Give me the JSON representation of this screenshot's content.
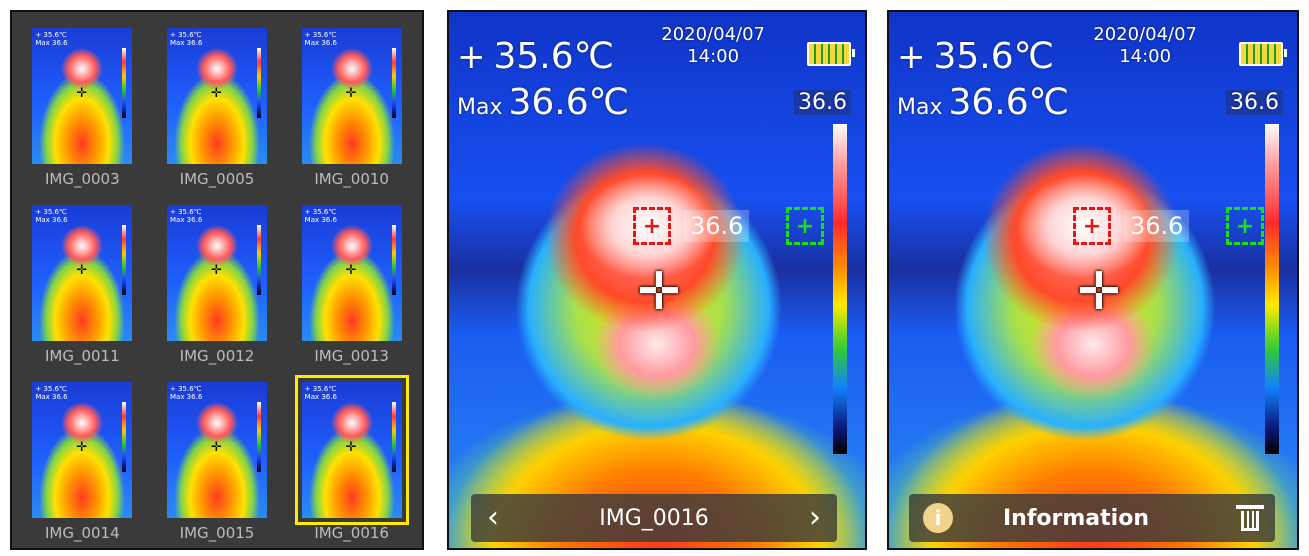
{
  "gallery": {
    "items": [
      {
        "name": "IMG_0003"
      },
      {
        "name": "IMG_0005"
      },
      {
        "name": "IMG_0010"
      },
      {
        "name": "IMG_0011"
      },
      {
        "name": "IMG_0012"
      },
      {
        "name": "IMG_0013"
      },
      {
        "name": "IMG_0014"
      },
      {
        "name": "IMG_0015"
      },
      {
        "name": "IMG_0016",
        "selected": true
      }
    ]
  },
  "viewer": {
    "center_temp": "35.6℃",
    "max_label": "Max",
    "max_temp": "36.6℃",
    "date": "2020/04/07",
    "time": "14:00",
    "scale_max": "36.6",
    "spot_value": "36.6",
    "image_name": "IMG_0016",
    "prev_icon": "chevron-left-icon",
    "next_icon": "chevron-right-icon"
  },
  "info_view": {
    "center_temp": "35.6℃",
    "max_label": "Max",
    "max_temp": "36.6℃",
    "date": "2020/04/07",
    "time": "14:00",
    "scale_max": "36.6",
    "spot_value": "36.6",
    "info_label": "Information",
    "info_icon": "info-icon",
    "delete_icon": "trash-icon"
  },
  "colors": {
    "selection": "#ffeb00",
    "gallery_bg": "#3a3a3a",
    "hot_marker": "#e81515",
    "cold_marker": "#18e018"
  }
}
